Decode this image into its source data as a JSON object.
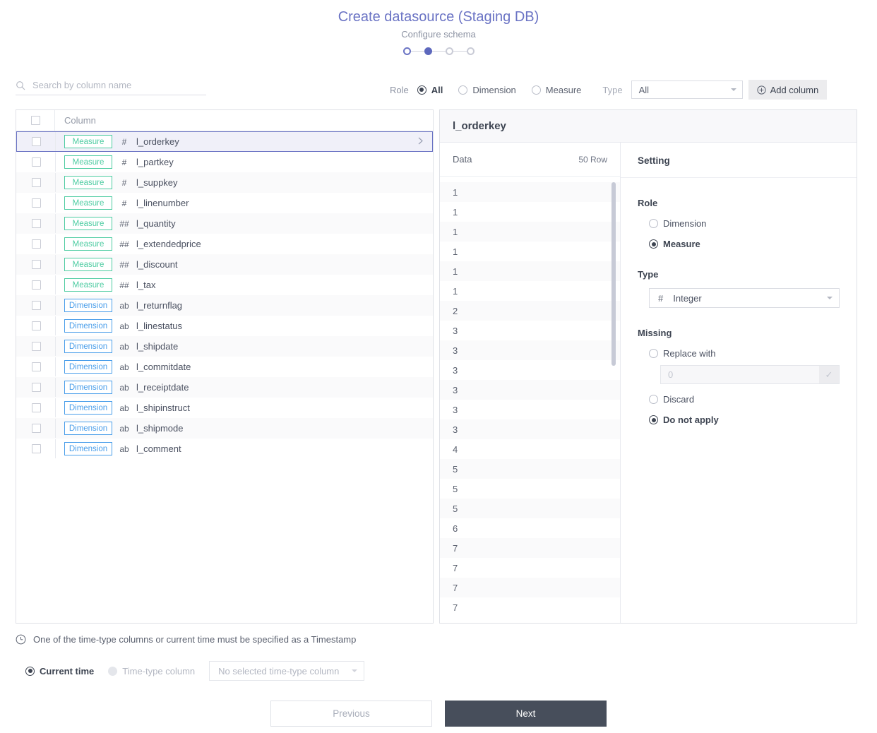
{
  "header": {
    "title": "Create datasource (Staging DB)",
    "subtitle": "Configure schema",
    "steps": [
      {
        "state": "done"
      },
      {
        "state": "active"
      },
      {
        "state": "todo"
      },
      {
        "state": "todo"
      }
    ]
  },
  "toolbar": {
    "search_placeholder": "Search by column name",
    "search_value": "",
    "role_label": "Role",
    "role_options": [
      {
        "label": "All",
        "selected": true
      },
      {
        "label": "Dimension",
        "selected": false
      },
      {
        "label": "Measure",
        "selected": false
      }
    ],
    "type_label": "Type",
    "type_value": "All",
    "add_column_label": "Add column"
  },
  "columns_table": {
    "header": "Column",
    "rows": [
      {
        "role": "Measure",
        "type_icon": "#",
        "name": "l_orderkey",
        "selected": true
      },
      {
        "role": "Measure",
        "type_icon": "#",
        "name": "l_partkey",
        "selected": false
      },
      {
        "role": "Measure",
        "type_icon": "#",
        "name": "l_suppkey",
        "selected": false
      },
      {
        "role": "Measure",
        "type_icon": "#",
        "name": "l_linenumber",
        "selected": false
      },
      {
        "role": "Measure",
        "type_icon": "##",
        "name": "l_quantity",
        "selected": false
      },
      {
        "role": "Measure",
        "type_icon": "##",
        "name": "l_extendedprice",
        "selected": false
      },
      {
        "role": "Measure",
        "type_icon": "##",
        "name": "l_discount",
        "selected": false
      },
      {
        "role": "Measure",
        "type_icon": "##",
        "name": "l_tax",
        "selected": false
      },
      {
        "role": "Dimension",
        "type_icon": "ab",
        "name": "l_returnflag",
        "selected": false
      },
      {
        "role": "Dimension",
        "type_icon": "ab",
        "name": "l_linestatus",
        "selected": false
      },
      {
        "role": "Dimension",
        "type_icon": "ab",
        "name": "l_shipdate",
        "selected": false
      },
      {
        "role": "Dimension",
        "type_icon": "ab",
        "name": "l_commitdate",
        "selected": false
      },
      {
        "role": "Dimension",
        "type_icon": "ab",
        "name": "l_receiptdate",
        "selected": false
      },
      {
        "role": "Dimension",
        "type_icon": "ab",
        "name": "l_shipinstruct",
        "selected": false
      },
      {
        "role": "Dimension",
        "type_icon": "ab",
        "name": "l_shipmode",
        "selected": false
      },
      {
        "role": "Dimension",
        "type_icon": "ab",
        "name": "l_comment",
        "selected": false
      }
    ]
  },
  "detail": {
    "title": "l_orderkey",
    "data": {
      "label": "Data",
      "row_count": "50 Row",
      "values": [
        "1",
        "1",
        "1",
        "1",
        "1",
        "1",
        "2",
        "3",
        "3",
        "3",
        "3",
        "3",
        "3",
        "4",
        "5",
        "5",
        "5",
        "6",
        "7",
        "7",
        "7",
        "7"
      ]
    },
    "setting": {
      "title": "Setting",
      "role_title": "Role",
      "role_options": [
        {
          "label": "Dimension",
          "selected": false
        },
        {
          "label": "Measure",
          "selected": true
        }
      ],
      "type_title": "Type",
      "type_icon": "#",
      "type_value": "Integer",
      "missing_title": "Missing",
      "missing_options": [
        {
          "label": "Replace with",
          "selected": false
        },
        {
          "label": "Discard",
          "selected": false
        },
        {
          "label": "Do not apply",
          "selected": true
        }
      ],
      "replace_placeholder": "0",
      "replace_value": ""
    }
  },
  "timestamp": {
    "note": "One of the time-type columns or current time must be specified as a Timestamp",
    "options": [
      {
        "label": "Current time",
        "selected": true,
        "disabled": false
      },
      {
        "label": "Time-type column",
        "selected": false,
        "disabled": true
      }
    ],
    "select_value": "No selected time-type column"
  },
  "footer": {
    "previous_label": "Previous",
    "next_label": "Next"
  },
  "colors": {
    "accent": "#6a73c4",
    "measure": "#4ecca2",
    "dimension": "#4a9eea",
    "next_button": "#474e5b"
  }
}
